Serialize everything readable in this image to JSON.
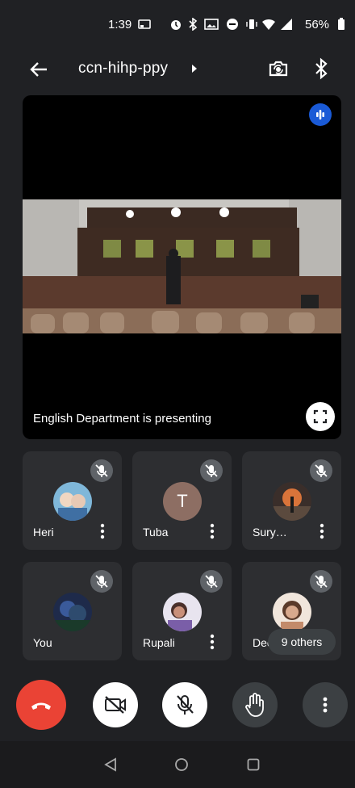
{
  "status_bar": {
    "time": "1:39",
    "battery": "56%",
    "icons": [
      "cast-icon",
      "alarm-icon",
      "bluetooth-icon",
      "gallery-icon",
      "dnd-icon",
      "vibrate-icon",
      "wifi-icon",
      "signal-icon",
      "battery-icon"
    ]
  },
  "topbar": {
    "meeting_code": "ccn-hihp-ppy",
    "back_icon": "arrow-left-icon",
    "caret_icon": "caret-right-icon",
    "switch_camera_icon": "switch-camera-icon",
    "bluetooth_icon": "bluetooth-icon"
  },
  "presentation": {
    "label": "English Department is presenting",
    "speaking_icon": "speaking-indicator-icon",
    "fullscreen_icon": "fullscreen-icon"
  },
  "participants": [
    {
      "name": "Heri",
      "muted": true,
      "avatar": "photo"
    },
    {
      "name": "Tuba",
      "muted": true,
      "avatar": "initial",
      "initial": "T",
      "color": "#8d6e63"
    },
    {
      "name": "Sury…",
      "muted": true,
      "avatar": "photo"
    },
    {
      "name": "You",
      "muted": true,
      "avatar": "photo"
    },
    {
      "name": "Rupali",
      "muted": true,
      "avatar": "photo"
    },
    {
      "name": "Dee…",
      "muted": true,
      "avatar": "photo"
    }
  ],
  "others_label": "9 others",
  "controls": {
    "end_call": "end-call-icon",
    "camera_off": "camera-off-icon",
    "mic_off": "mic-off-icon",
    "raise_hand": "raise-hand-icon",
    "more": "more-vert-icon"
  },
  "colors": {
    "background": "#202124",
    "tile": "#2d2e31",
    "end_call": "#ea4335",
    "speaking": "#1a5ad6"
  },
  "navbar": {
    "back": "nav-back-icon",
    "home": "nav-home-icon",
    "recents": "nav-recents-icon"
  }
}
